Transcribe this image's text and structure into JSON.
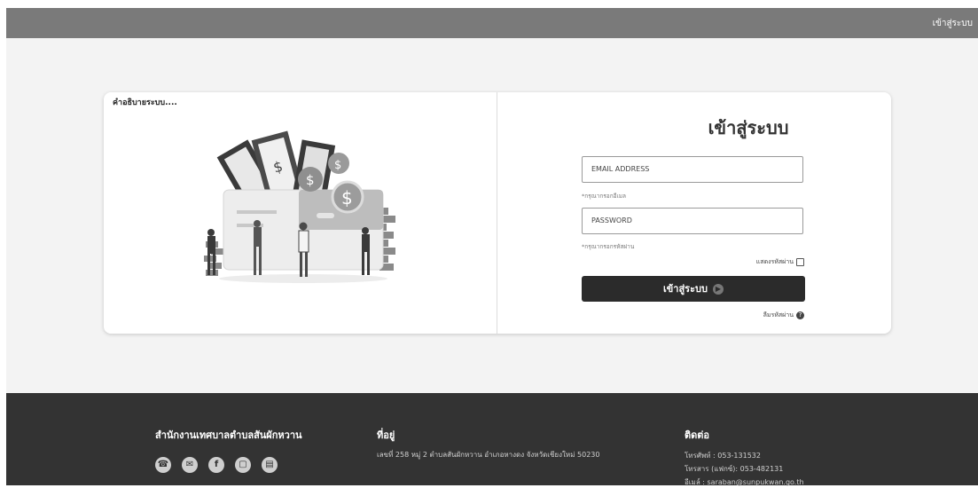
{
  "header": {
    "login_link": "เข้าสู่ระบบ"
  },
  "card": {
    "description": "คำอธิบายระบบ....",
    "login_title": "เข้าสู่ระบบ",
    "email_placeholder": "EMAIL ADDRESS",
    "email_hint": "*กรุณากรอกอีเมล",
    "password_placeholder": "PASSWORD",
    "password_hint": "*กรุณากรอกรหัสผ่าน",
    "show_password": "แสดงรหัสผ่าน",
    "login_button": "เข้าสู่ระบบ",
    "forgot_password": "ลืมรหัสผ่าน"
  },
  "footer": {
    "org_name": "สำนักงานเทศบาลตำบลสันผักหวาน",
    "address_title": "ที่อยู่",
    "address": "เลขที่ 258 หมู่ 2 ตำบลสันผักหวาน อำเภอหางดง จังหวัดเชียงใหม่ 50230",
    "contact_title": "ติดต่อ",
    "phone": "โทรศัพท์ : 053-131532",
    "fax": "โทรสาร (แฟกซ์): 053-482131",
    "email": "อีเมล์ : saraban@sunpukwan.go.th",
    "social_icons": [
      "phone-icon",
      "mail-icon",
      "facebook-icon",
      "line-icon",
      "web-icon"
    ]
  },
  "colors": {
    "header": "#7a7a7a",
    "footer": "#333333",
    "button": "#2b2b2b"
  }
}
